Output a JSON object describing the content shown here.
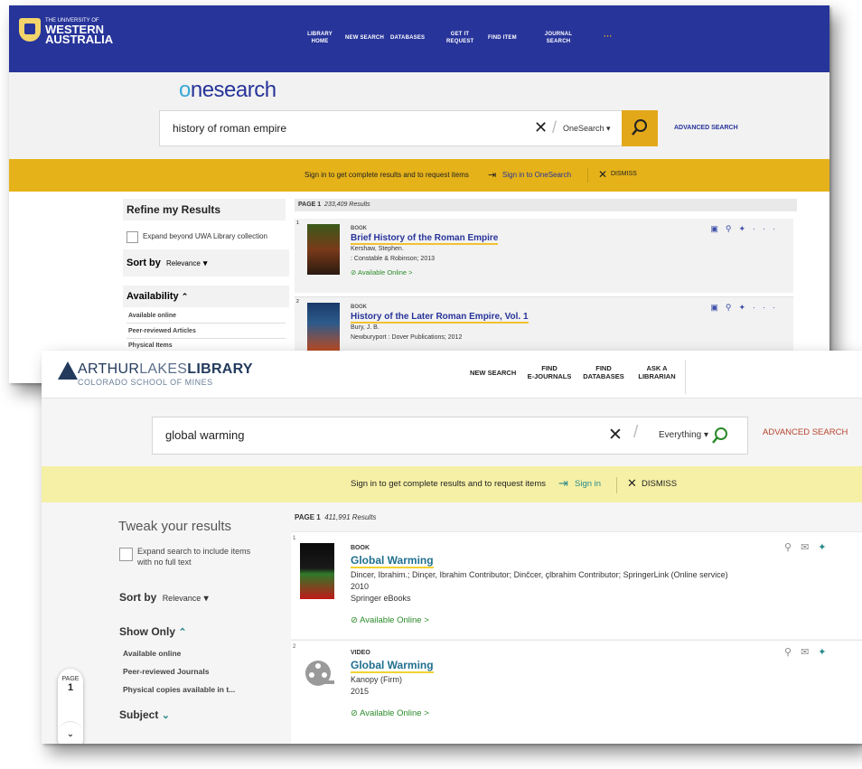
{
  "uwa": {
    "logo": {
      "line1": "THE UNIVERSITY OF",
      "line2": "WESTERN",
      "line3": "AUSTRALIA"
    },
    "nav": [
      {
        "label": "LIBRARY\nHOME"
      },
      {
        "label": "NEW SEARCH"
      },
      {
        "label": "DATABASES"
      },
      {
        "label": "GET IT\nREQUEST"
      },
      {
        "label": "FIND ITEM"
      },
      {
        "label": "JOURNAL\nSEARCH"
      },
      {
        "label": "···"
      }
    ],
    "brand_o": "o",
    "brand_rest": "nesearch",
    "search": {
      "query": "history of roman empire",
      "scope": "OneSearch",
      "advanced": "ADVANCED SEARCH"
    },
    "banner": {
      "text": "Sign in to get complete results and to request items",
      "signin": "Sign in to OneSearch",
      "dismiss": "DISMISS"
    },
    "sidebar": {
      "refine_title": "Refine my Results",
      "expand_label": "Expand beyond UWA Library collection",
      "sort_label": "Sort by",
      "sort_value": "Relevance",
      "availability_label": "Availability",
      "filters": [
        "Available online",
        "Peer-reviewed Articles",
        "Physical Items"
      ]
    },
    "page_label": "PAGE 1",
    "results_count": "233,409 Results",
    "results": [
      {
        "num": "1",
        "type": "BOOK",
        "title": "Brief History of the Roman Empire",
        "author": "Kershaw, Stephen.",
        "pub": ": Constable & Robinson; 2013",
        "availability": "Available Online >"
      },
      {
        "num": "2",
        "type": "BOOK",
        "title": "History of the Later Roman Empire, Vol. 1",
        "author": "Bury, J. B.",
        "pub": "Newburyport : Dover Publications; 2012",
        "availability": ""
      }
    ]
  },
  "al": {
    "logo": {
      "arthur": "ARTHUR",
      "lakes": "LAKES",
      "library": "LIBRARY",
      "sub": "COLORADO SCHOOL OF MINES"
    },
    "nav": [
      {
        "label": "NEW SEARCH"
      },
      {
        "label": "FIND\nE-JOURNALS"
      },
      {
        "label": "FIND\nDATABASES"
      },
      {
        "label": "ASK A\nLIBRARIAN"
      }
    ],
    "search": {
      "query": "global warming",
      "scope": "Everything",
      "advanced": "ADVANCED SEARCH"
    },
    "banner": {
      "text": "Sign in to get complete results and to request items",
      "signin": "Sign in",
      "dismiss": "DISMISS"
    },
    "sidebar": {
      "tweak_title": "Tweak your results",
      "expand_label": "Expand search to include items with no full text",
      "sort_label": "Sort by",
      "sort_value": "Relevance",
      "show_only": "Show Only",
      "filters": [
        "Available online",
        "Peer-reviewed Journals",
        "Physical copies available in t..."
      ],
      "subject": "Subject",
      "page_pill_label": "PAGE",
      "page_pill_num": "1"
    },
    "page_label": "PAGE 1",
    "results_count": "411,991 Results",
    "results": [
      {
        "num": "1",
        "type": "BOOK",
        "title": "Global Warming",
        "author": "Dincer, Ibrahim.; Dinçer, Ibrahim Contributor; Dinĉcer, çlbrahim Contributor; SpringerLink (Online service)",
        "year": "2010",
        "pub": "Springer eBooks",
        "availability": "Available Online >"
      },
      {
        "num": "2",
        "type": "VIDEO",
        "title": "Global Warming",
        "author": "Kanopy (Firm)",
        "year": "2015",
        "pub": "",
        "availability": "Available Online >"
      }
    ]
  },
  "colors": {
    "uwa_blue": "#27349a",
    "uwa_gold": "#e5b21a",
    "al_navy": "#233a5c",
    "al_banner": "#f6f0a6",
    "al_link": "#1f6f8e",
    "available_green": "#2a8a2a"
  }
}
